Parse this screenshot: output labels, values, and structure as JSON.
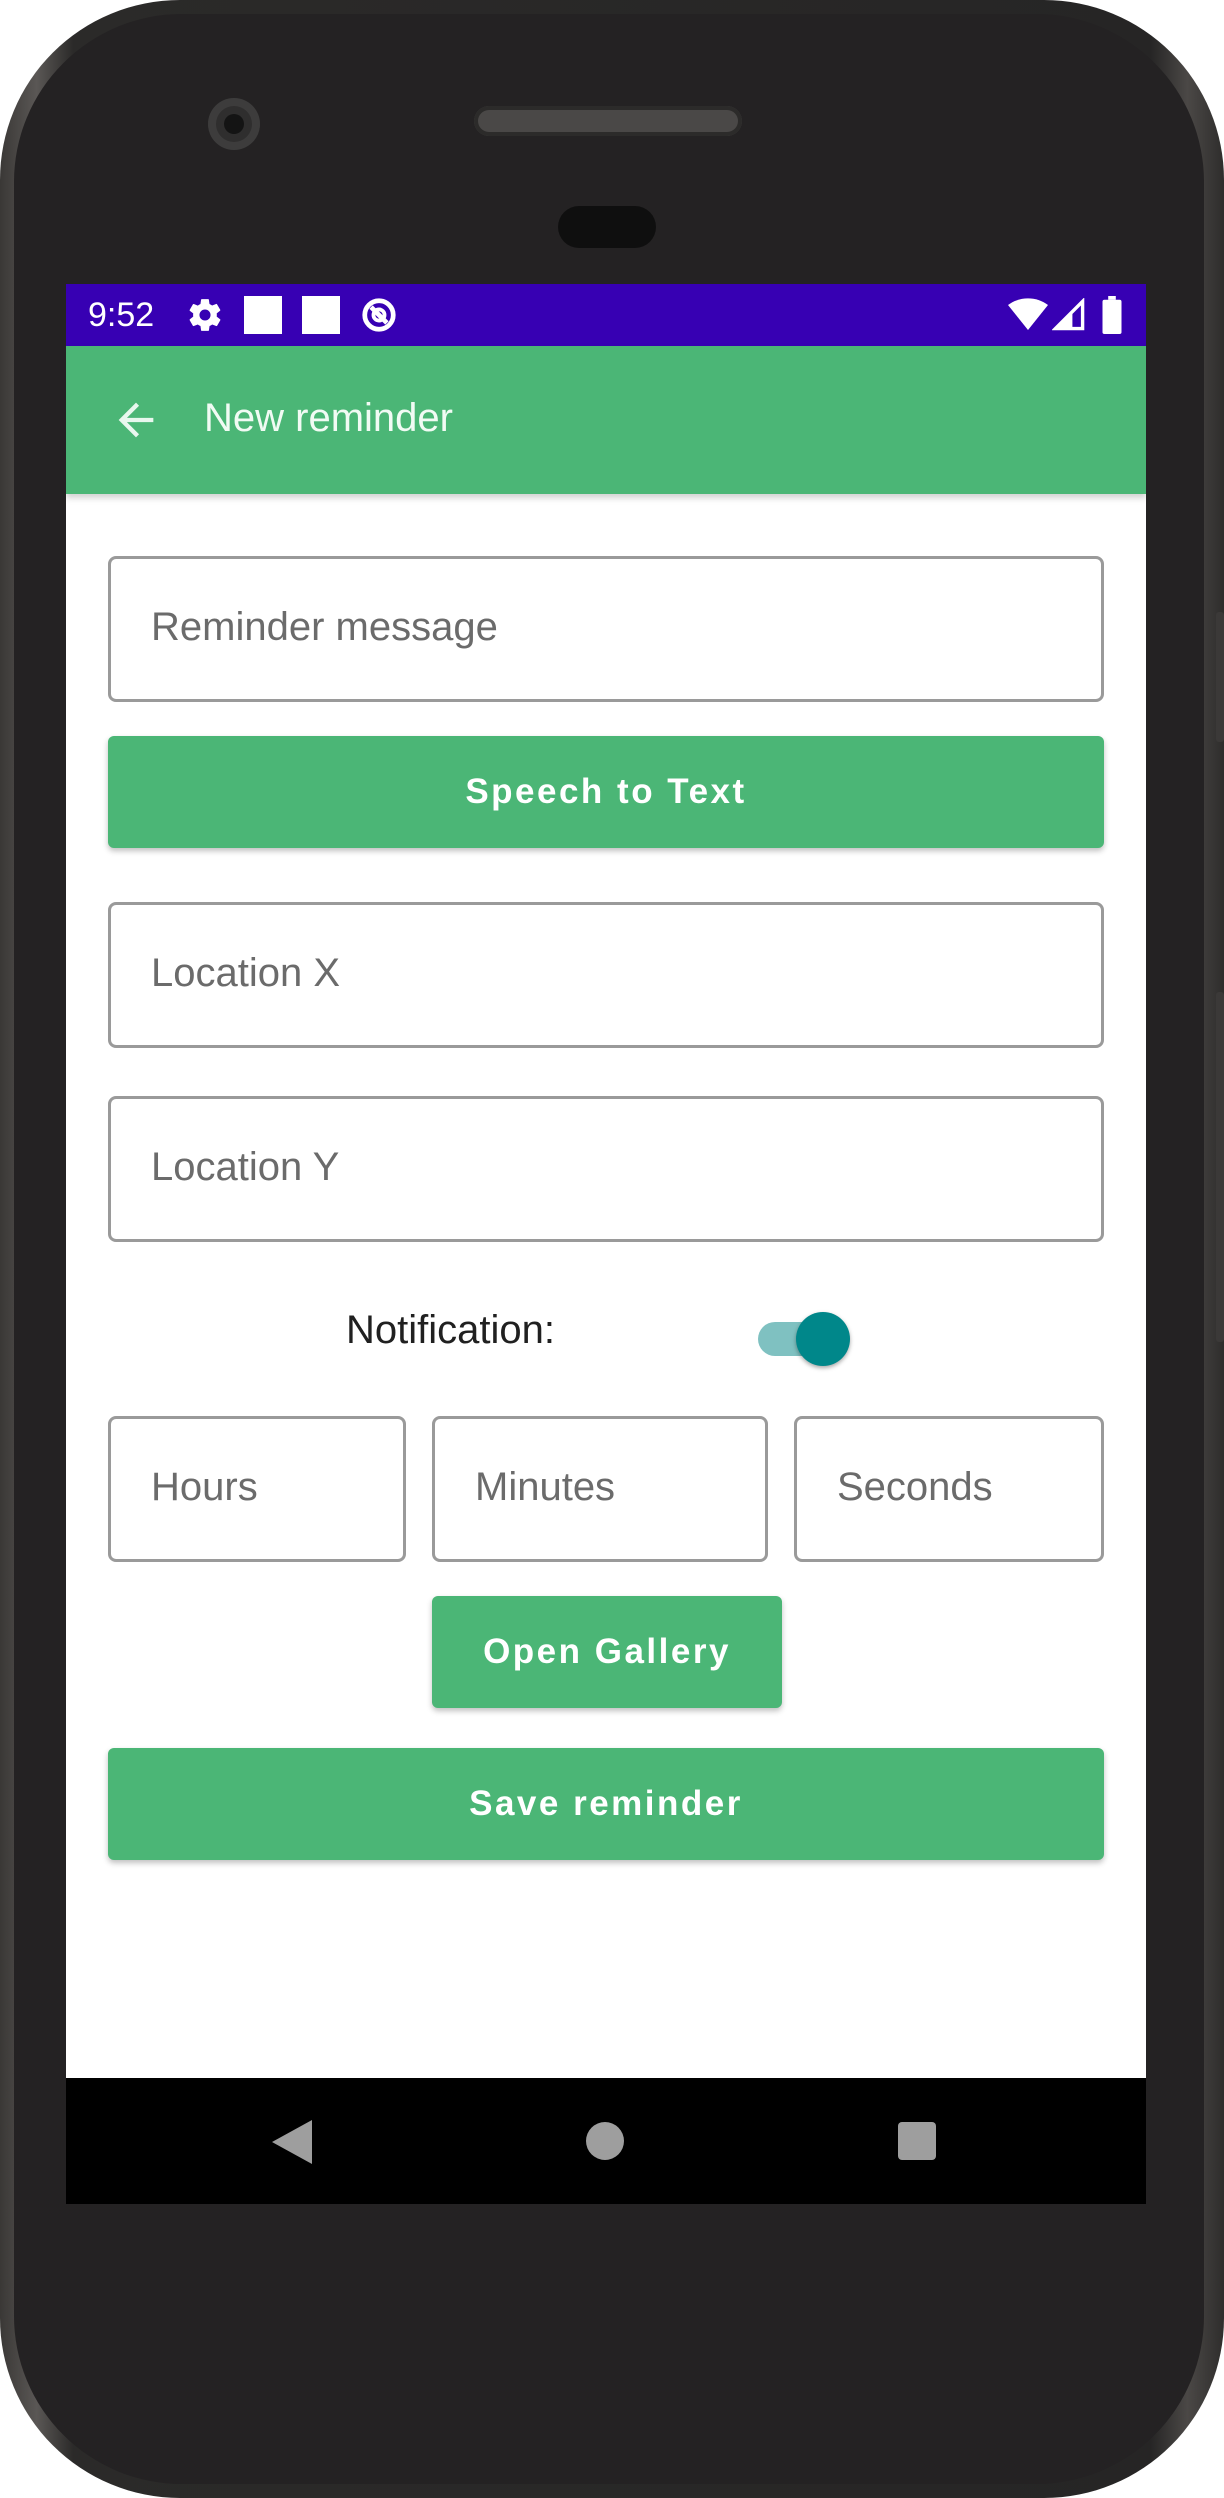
{
  "status_bar": {
    "time": "9:52",
    "left_icons": [
      "gear-icon",
      "notification-square-icon",
      "notification-square-icon",
      "data-saver-icon"
    ],
    "right_icons": [
      "wifi-icon",
      "signal-icon",
      "battery-icon"
    ],
    "color": "#3700b3"
  },
  "app_bar": {
    "title": "New reminder",
    "back_icon": "arrow-left-icon",
    "color": "#4bb676"
  },
  "form": {
    "message_placeholder": "Reminder message",
    "speech_button": "Speech to Text",
    "location_x_placeholder": "Location X",
    "location_y_placeholder": "Location Y",
    "notification_label": "Notification:",
    "notification_enabled": true,
    "hours_placeholder": "Hours",
    "minutes_placeholder": "Minutes",
    "seconds_placeholder": "Seconds",
    "gallery_button": "Open Gallery",
    "save_button": "Save reminder"
  },
  "nav_bar": {
    "icons": [
      "nav-back-icon",
      "nav-home-icon",
      "nav-recents-icon"
    ]
  },
  "colors": {
    "accent": "#4bb676",
    "switch_thumb": "#00878a",
    "switch_track": "#7fc1c1"
  }
}
